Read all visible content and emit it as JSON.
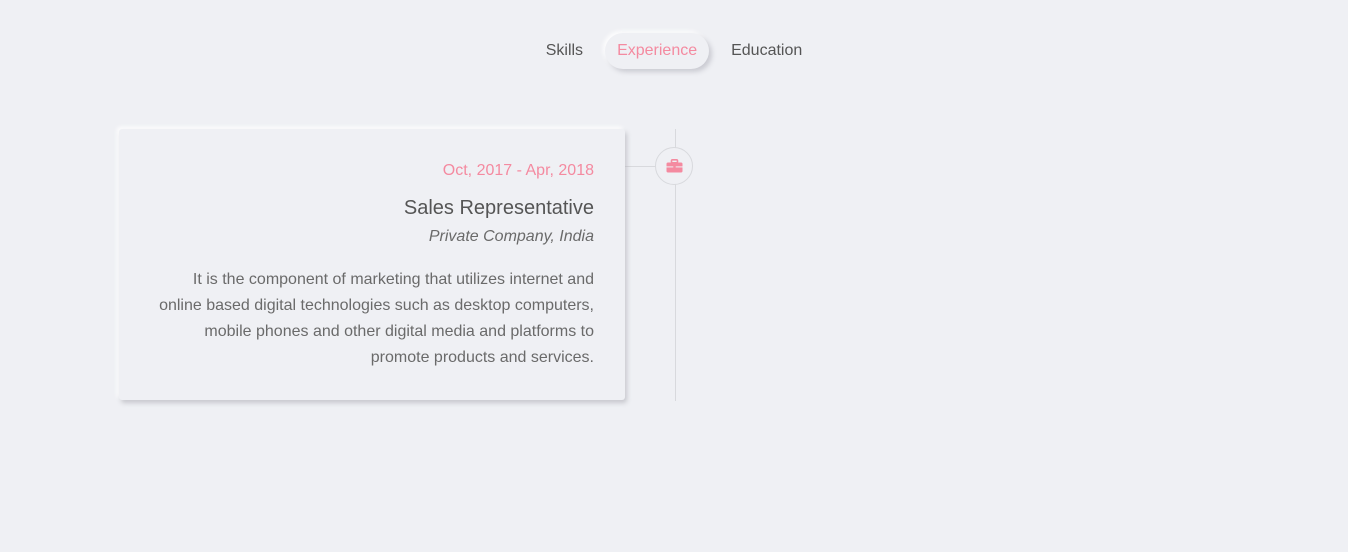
{
  "tabs": [
    {
      "label": "Skills",
      "active": false
    },
    {
      "label": "Experience",
      "active": true
    },
    {
      "label": "Education",
      "active": false
    }
  ],
  "timeline": {
    "items": [
      {
        "date": "Oct, 2017 - Apr, 2018",
        "title": "Sales Representative",
        "company": "Private Company, India",
        "description": "It is the component of marketing that utilizes internet and online based digital technologies such as desktop computers, mobile phones and other digital media and platforms to promote products and services.",
        "icon": "briefcase-icon"
      }
    ]
  },
  "colors": {
    "accent": "#f48aa0",
    "background": "#eff0f4",
    "text": "#555555"
  }
}
